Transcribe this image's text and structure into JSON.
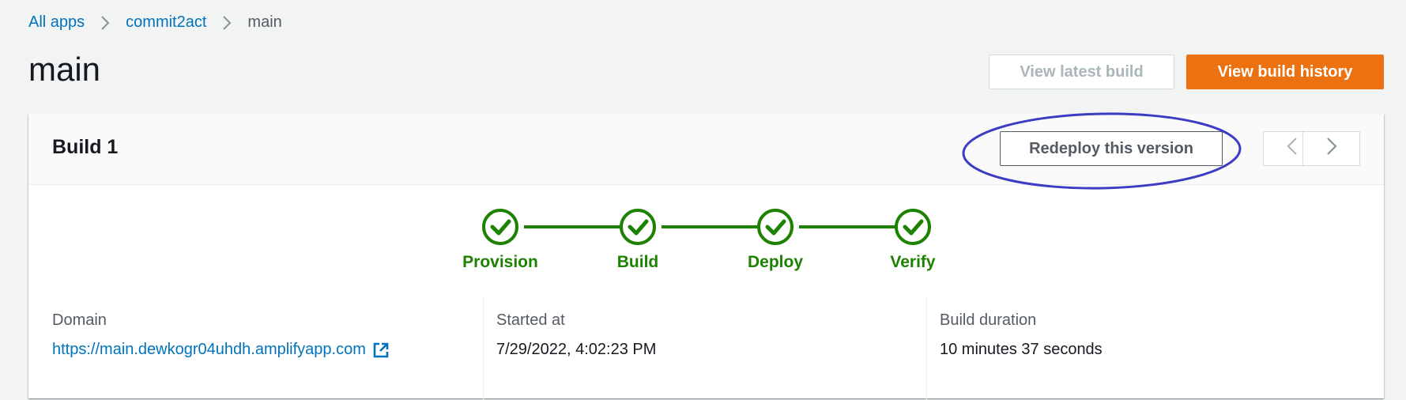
{
  "breadcrumb": {
    "items": [
      {
        "label": "All apps"
      },
      {
        "label": "commit2act"
      },
      {
        "label": "main"
      }
    ]
  },
  "page": {
    "title": "main"
  },
  "actions": {
    "view_latest_build": "View latest build",
    "view_build_history": "View build history"
  },
  "build": {
    "title": "Build 1",
    "redeploy_label": "Redeploy this version",
    "steps": [
      {
        "label": "Provision",
        "status": "success"
      },
      {
        "label": "Build",
        "status": "success"
      },
      {
        "label": "Deploy",
        "status": "success"
      },
      {
        "label": "Verify",
        "status": "success"
      }
    ],
    "details": {
      "domain": {
        "label": "Domain",
        "value": "https://main.dewkogr04uhdh.amplifyapp.com"
      },
      "started_at": {
        "label": "Started at",
        "value": "7/29/2022, 4:02:23 PM"
      },
      "duration": {
        "label": "Build duration",
        "value": "10 minutes 37 seconds"
      }
    }
  },
  "colors": {
    "link": "#0073bb",
    "primary": "#ec7211",
    "success": "#1d8102",
    "annotation": "#3b3bc4"
  },
  "icons": {
    "breadcrumb_separator": "chevron-right-icon",
    "previous": "chevron-left-icon",
    "next": "chevron-right-icon",
    "step_status": "check-circle-icon",
    "external_link": "external-link-icon"
  }
}
